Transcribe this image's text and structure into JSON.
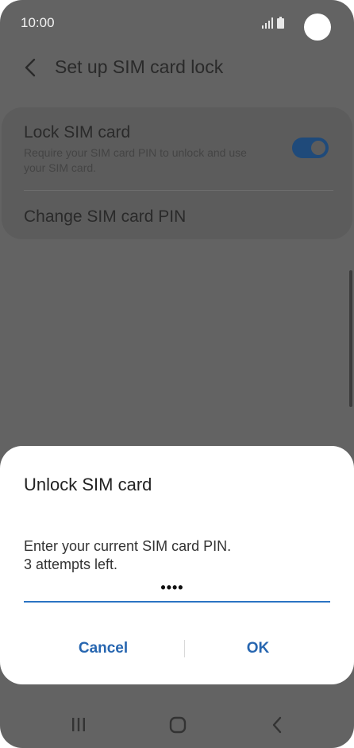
{
  "status_bar": {
    "time": "10:00",
    "icons": [
      "signal-icon",
      "battery-icon"
    ]
  },
  "header": {
    "title": "Set up SIM card lock",
    "back_icon": "chevron-left-icon"
  },
  "settings": {
    "lock_sim": {
      "title": "Lock SIM card",
      "summary": "Require your SIM card PIN to unlock and use your SIM card.",
      "toggle_on": true
    },
    "change_pin": {
      "title": "Change SIM card PIN"
    }
  },
  "dialog": {
    "title": "Unlock SIM card",
    "message_line1": "Enter your current SIM card PIN.",
    "message_line2": "3 attempts left.",
    "pin_value": "••••",
    "cancel_label": "Cancel",
    "ok_label": "OK"
  },
  "nav_bar": {
    "icons": [
      "recents-icon",
      "home-icon",
      "back-icon"
    ]
  },
  "colors": {
    "accent": "#2766b0",
    "scrim_background": "#636363",
    "toggle_on": "#1f4a7a"
  }
}
